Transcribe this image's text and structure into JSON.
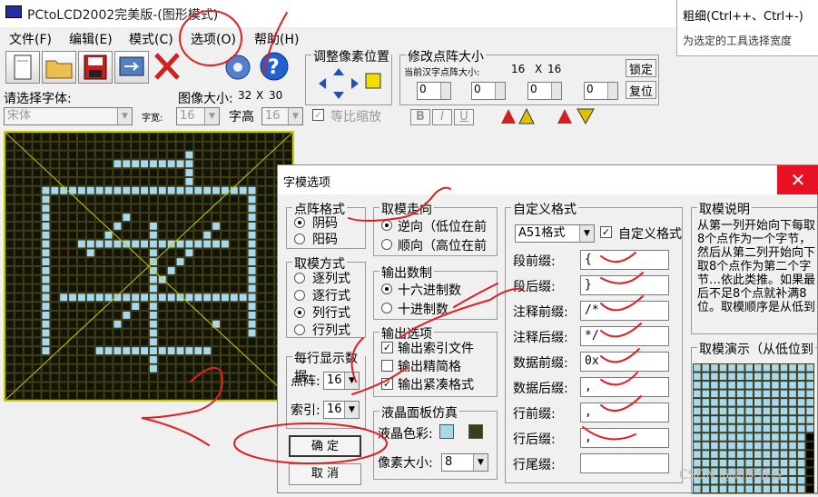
{
  "window": {
    "title": "PCtoLCD2002完美版-(图形模式)"
  },
  "tooltip": {
    "title": "粗细(Ctrl++、Ctrl+-)",
    "desc": "为选定的工具选择宽度"
  },
  "menu": [
    "文件(F)",
    "编辑(E)",
    "模式(C)",
    "选项(O)",
    "帮助(H)"
  ],
  "adjust": {
    "title": "调整像素位置"
  },
  "modify": {
    "title": "修改点阵大小",
    "current_label": "当前汉字点阵大小:",
    "size_w": "16",
    "size_x": "X",
    "size_h": "16",
    "lock": "锁定",
    "reset": "复位",
    "spins": [
      "0",
      "0",
      "0",
      "0"
    ]
  },
  "font": {
    "select_label": "请选择字体:",
    "value": "宋体",
    "width_label": "字宽:",
    "width_value": "16",
    "height_label": "字高",
    "height_value": "16",
    "ratio_label": "等比缩放"
  },
  "image_size": {
    "label": "图像大小:",
    "w": "32",
    "x": "X",
    "h": "30"
  },
  "format_buttons": [
    "B",
    "I",
    "U"
  ],
  "dialog": {
    "title": "字模选项",
    "close": "✕",
    "matrix_format": {
      "title": "点阵格式",
      "options": [
        "阴码",
        "阳码"
      ],
      "selected": 0
    },
    "scan_dir": {
      "title": "取模走向",
      "options": [
        "逆向（低位在前",
        "顺向（高位在前"
      ],
      "selected": 0
    },
    "mode": {
      "title": "取模方式",
      "options": [
        "逐列式",
        "逐行式",
        "列行式",
        "行列式"
      ],
      "selected": 2
    },
    "output_base": {
      "title": "输出数制",
      "options": [
        "十六进制数",
        "十进制数"
      ],
      "selected": 0
    },
    "output_opts": {
      "title": "输出选项",
      "options": [
        "输出索引文件",
        "输出精简格",
        "输出紧凑格式"
      ]
    },
    "per_row": {
      "title": "每行显示数据",
      "dot_label": "点阵:",
      "dot_value": "16",
      "index_label": "索引:",
      "index_value": "16"
    },
    "lcd": {
      "title": "液晶面板仿真",
      "color_label": "液晶色彩:",
      "pixel_label": "像素大小:",
      "pixel_value": "8",
      "color1": "#a6d9f0",
      "color2": "#3e3d1b"
    },
    "custom": {
      "title": "自定义格式",
      "preset": "A51格式",
      "custom_label": "自定义格式",
      "rows": [
        {
          "label": "段前缀:",
          "value": "{"
        },
        {
          "label": "段后缀:",
          "value": "}"
        },
        {
          "label": "注释前缀:",
          "value": "/*"
        },
        {
          "label": "注释后缀:",
          "value": "*/"
        },
        {
          "label": "数据前缀:",
          "value": "0x"
        },
        {
          "label": "数据后缀:",
          "value": ","
        },
        {
          "label": "行前缀:",
          "value": ","
        },
        {
          "label": "行后缀:",
          "value": ","
        },
        {
          "label": "行尾缀:",
          "value": ""
        }
      ]
    },
    "description": {
      "title": "取模说明",
      "text": "从第一列开始向下每取8个点作为一个字节，然后从第二列开始向下取8个点作为第二个字节…依此类推。如果最后不足8个点就补满8位。取模顺序是从低到"
    },
    "demo": {
      "title": "取模演示（从低位到"
    },
    "ok": "确 定",
    "cancel": "取 消"
  },
  "watermark": "CSDN @高原低谷"
}
